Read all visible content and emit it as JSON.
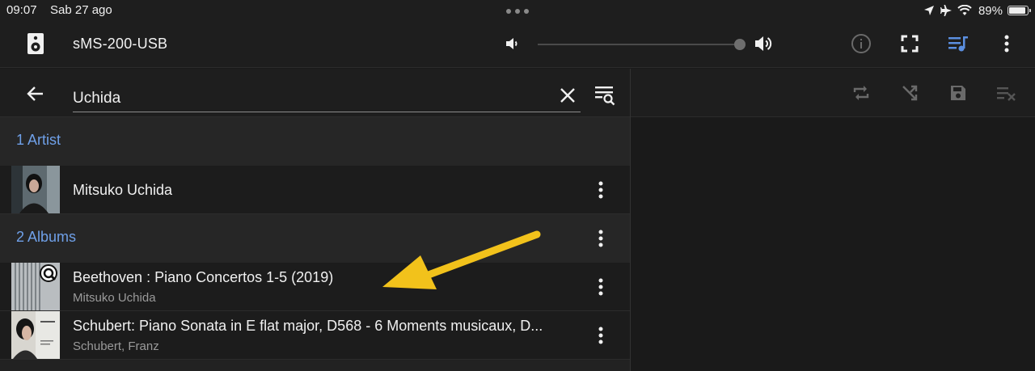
{
  "status_bar": {
    "time": "09:07",
    "date": "Sab 27 ago",
    "battery_percent": "89%",
    "battery_level": 0.89,
    "icons": [
      "location-icon",
      "airplane-icon",
      "wifi-icon",
      "battery-icon"
    ]
  },
  "app_bar": {
    "device_name": "sMS-200-USB",
    "volume_level": 1.0,
    "actions": [
      "info-icon",
      "fullscreen-icon",
      "queue-icon",
      "more-vert-icon"
    ],
    "accent_color": "#5b8fe0"
  },
  "search": {
    "query": "Uchida"
  },
  "sections": {
    "artists": {
      "title": "1 Artist",
      "items": [
        {
          "title": "Mitsuko Uchida"
        }
      ]
    },
    "albums": {
      "title": "2 Albums",
      "items": [
        {
          "title": "Beethoven : Piano Concertos 1-5 (2019)",
          "subtitle": "Mitsuko Uchida"
        },
        {
          "title": "Schubert: Piano Sonata in E flat major, D568 - 6 Moments musicaux, D...",
          "subtitle": "Schubert, Franz"
        }
      ]
    }
  },
  "queue_toolbar": {
    "actions": [
      "repeat-icon",
      "shuffle-icon",
      "save-icon",
      "clear-queue-icon"
    ]
  },
  "annotation": {
    "arrow_color": "#f2c21b"
  }
}
